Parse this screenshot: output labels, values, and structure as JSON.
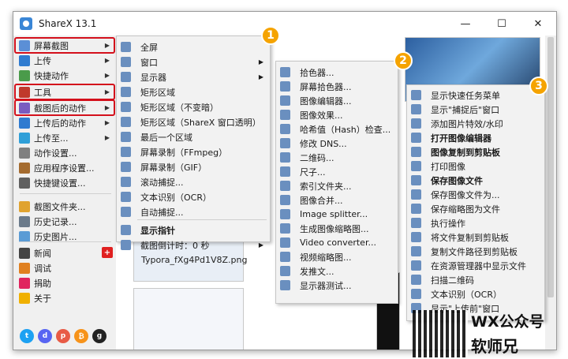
{
  "window": {
    "title": "ShareX 13.1",
    "min": "—",
    "max": "☐",
    "close": "✕"
  },
  "sidebar": {
    "items": [
      {
        "label": "屏幕截图",
        "icon": "camera-icon",
        "color": "#5b8fd6",
        "arrow": true,
        "hl": true
      },
      {
        "label": "上传",
        "icon": "upload-icon",
        "color": "#2f7bd0",
        "arrow": true
      },
      {
        "label": "快捷动作",
        "icon": "workflow-icon",
        "color": "#4a9b4a",
        "arrow": true
      },
      {
        "label": "工具",
        "icon": "toolbox-icon",
        "color": "#c0392b",
        "arrow": true,
        "hl": true
      },
      {
        "label": "截图后的动作",
        "icon": "after-capture-icon",
        "color": "#7a5cc0",
        "arrow": true,
        "hl": true
      },
      {
        "label": "上传后的动作",
        "icon": "after-upload-icon",
        "color": "#2f7bd0",
        "arrow": true
      },
      {
        "label": "上传至...",
        "icon": "destination-icon",
        "color": "#2f9fd8",
        "arrow": true
      },
      {
        "label": "动作设置...",
        "icon": "gear-icon",
        "color": "#808080"
      },
      {
        "label": "应用程序设置...",
        "icon": "wrench-icon",
        "color": "#a46b2f"
      },
      {
        "label": "快捷键设置...",
        "icon": "keyboard-icon",
        "color": "#606060"
      },
      {
        "label": "截图文件夹...",
        "icon": "folder-icon",
        "color": "#e0a330"
      },
      {
        "label": "历史记录...",
        "icon": "history-icon",
        "color": "#6a7a8a"
      },
      {
        "label": "历史图片...",
        "icon": "image-history-icon",
        "color": "#5a9bd5"
      },
      {
        "label": "新闻",
        "icon": "news-icon",
        "color": "#444"
      },
      {
        "label": "调试",
        "icon": "debug-icon",
        "color": "#e08020"
      },
      {
        "label": "捐助",
        "icon": "heart-icon",
        "color": "#e0245e"
      },
      {
        "label": "关于",
        "icon": "info-icon",
        "color": "#f0b000"
      }
    ],
    "news_badge": "+"
  },
  "capture_menu": {
    "items": [
      {
        "label": "全屏",
        "icon": "fullscreen-icon"
      },
      {
        "label": "窗口",
        "icon": "window-icon",
        "arrow": true
      },
      {
        "label": "显示器",
        "icon": "monitor-icon",
        "arrow": true
      },
      {
        "label": "矩形区域",
        "icon": "rect-region-icon"
      },
      {
        "label": "矩形区域（不变暗）",
        "icon": "rect-light-icon"
      },
      {
        "label": "矩形区域（ShareX 窗口透明）",
        "icon": "rect-transparent-icon"
      },
      {
        "label": "最后一个区域",
        "icon": "last-region-icon"
      },
      {
        "label": "屏幕录制（FFmpeg）",
        "icon": "video-record-icon"
      },
      {
        "label": "屏幕录制（GIF）",
        "icon": "gif-record-icon"
      },
      {
        "label": "滚动捕捉...",
        "icon": "scroll-capture-icon"
      },
      {
        "label": "文本识别（OCR）",
        "icon": "ocr-icon"
      },
      {
        "label": "自动捕捉...",
        "icon": "auto-capture-icon"
      },
      {
        "label": "显示指针",
        "icon": "cursor-icon",
        "bold": true
      },
      {
        "label": "截图倒计时：0 秒",
        "icon": "timer-icon",
        "arrow": true
      }
    ]
  },
  "tools_menu": {
    "items": [
      {
        "label": "拾色器...",
        "icon": "color-wheel-icon"
      },
      {
        "label": "屏幕拾色器...",
        "icon": "eyedropper-icon"
      },
      {
        "label": "图像编辑器...",
        "icon": "image-editor-icon"
      },
      {
        "label": "图像效果...",
        "icon": "image-effects-icon"
      },
      {
        "label": "哈希值（Hash）检查...",
        "icon": "hash-icon"
      },
      {
        "label": "修改 DNS...",
        "icon": "dns-icon"
      },
      {
        "label": "二维码...",
        "icon": "qrcode-icon"
      },
      {
        "label": "尺子...",
        "icon": "ruler-icon"
      },
      {
        "label": "索引文件夹...",
        "icon": "index-folder-icon"
      },
      {
        "label": "图像合并...",
        "icon": "image-combine-icon"
      },
      {
        "label": "Image splitter...",
        "icon": "image-split-icon"
      },
      {
        "label": "生成图像缩略图...",
        "icon": "thumbnail-icon"
      },
      {
        "label": "Video converter...",
        "icon": "video-convert-icon"
      },
      {
        "label": "视频缩略图...",
        "icon": "video-thumb-icon"
      },
      {
        "label": "发推文...",
        "icon": "twitter-icon"
      },
      {
        "label": "显示器测试...",
        "icon": "monitor-test-icon"
      }
    ]
  },
  "after_menu": {
    "items": [
      {
        "label": "显示快速任务菜单",
        "icon": "task-menu-icon"
      },
      {
        "label": "显示\"捕捉后\"窗口",
        "icon": "after-window-icon"
      },
      {
        "label": "添加图片特效/水印",
        "icon": "watermark-icon"
      },
      {
        "label": "打开图像编辑器",
        "icon": "open-editor-icon",
        "bold": true
      },
      {
        "label": "图像复制到剪贴板",
        "icon": "copy-image-icon",
        "bold": true
      },
      {
        "label": "打印图像",
        "icon": "print-icon"
      },
      {
        "label": "保存图像文件",
        "icon": "save-icon",
        "bold": true
      },
      {
        "label": "保存图像文件为...",
        "icon": "save-as-icon"
      },
      {
        "label": "保存缩略图为文件",
        "icon": "save-thumb-icon"
      },
      {
        "label": "执行操作",
        "icon": "run-icon"
      },
      {
        "label": "将文件复制到剪贴板",
        "icon": "copy-file-icon"
      },
      {
        "label": "复制文件路径到剪贴板",
        "icon": "copy-path-icon"
      },
      {
        "label": "在资源管理器中显示文件",
        "icon": "explorer-icon"
      },
      {
        "label": "扫描二维码",
        "icon": "scan-qr-icon"
      },
      {
        "label": "文本识别（OCR）",
        "icon": "ocr-icon"
      },
      {
        "label": "显示\"上传前\"窗口",
        "icon": "before-upload-icon"
      }
    ]
  },
  "badges": [
    "1",
    "2",
    "3"
  ],
  "gallery": {
    "caption": "Typora_fXg4Pd1V8Z.png"
  },
  "watermark": {
    "line1": "WX公众号",
    "line2": "软师兄"
  }
}
